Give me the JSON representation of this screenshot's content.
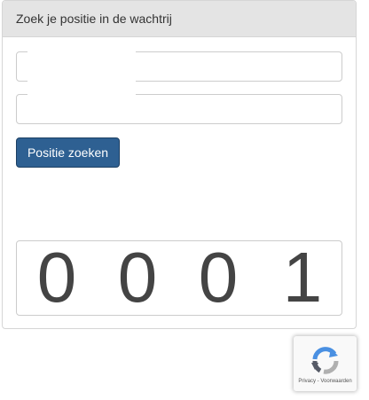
{
  "panel": {
    "heading": "Zoek je positie in de wachtrij"
  },
  "form": {
    "field1_value": "",
    "field2_value": "",
    "submit_label": "Positie zoeken"
  },
  "counter": {
    "digits": [
      "0",
      "0",
      "0",
      "1"
    ]
  },
  "recaptcha": {
    "footer_text": "Privacy - Voorwaarden",
    "icon": "recaptcha-logo-icon"
  },
  "colors": {
    "button_bg": "#2e6092",
    "heading_bg": "#e4e4e4",
    "digit_color": "#444444"
  }
}
